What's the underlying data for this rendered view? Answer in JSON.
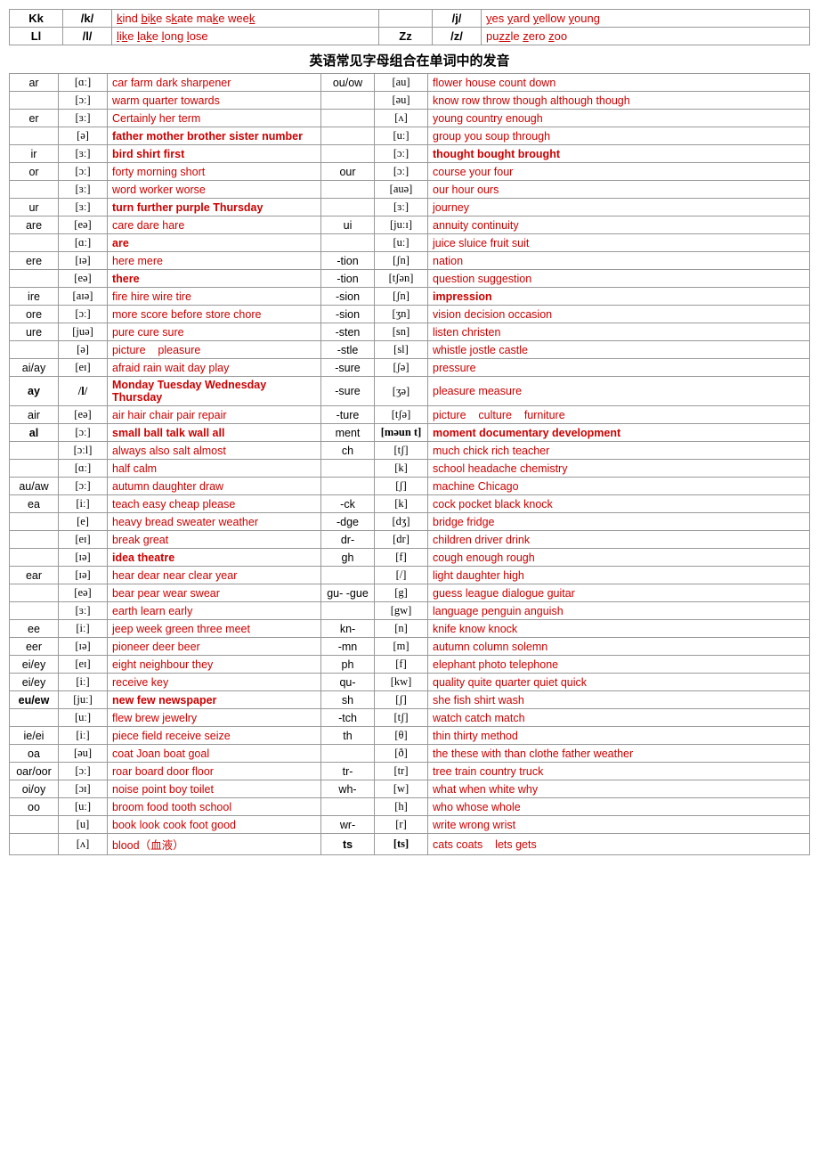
{
  "topTable": {
    "rows": [
      {
        "letter": "Kk",
        "ipa": "/k/",
        "examples": "kind bike skate make week",
        "letter2": "",
        "ipa2": "/j/",
        "examples2": "yes yard yellow young"
      },
      {
        "letter": "Ll",
        "ipa": "/l/",
        "examples": "like lake long lose",
        "letter2": "Zz",
        "ipa2": "/z/",
        "examples2": "puzzle zero zoo"
      }
    ]
  },
  "title": "英语常见字母组合在单词中的发音",
  "mainRows": [
    {
      "left_label": "ar",
      "left_phon": "[ɑː]",
      "left_words": "car farm dark sharpener",
      "right_label": "ou/ow",
      "right_phon": "[au]",
      "right_words": "flower house count down"
    },
    {
      "left_label": "",
      "left_phon": "[ɔː]",
      "left_words": "warm quarter towards",
      "right_label": "",
      "right_phon": "[əu]",
      "right_words": "know row throw though although though"
    },
    {
      "left_label": "er",
      "left_phon": "[ɜː]",
      "left_words": "Certainly her term",
      "right_label": "",
      "right_phon": "[ʌ]",
      "right_words": "young country enough"
    },
    {
      "left_label": "",
      "left_phon": "[ə]",
      "left_words_bold": "father mother brother sister number",
      "right_label": "",
      "right_phon": "[uː]",
      "right_words": "group you soup through"
    },
    {
      "left_label": "ir",
      "left_phon": "[ɜː]",
      "left_words_bold": "bird shirt first",
      "right_label": "",
      "right_phon": "[ɔː]",
      "right_words_bold": "thought bought brought"
    },
    {
      "left_label": "or",
      "left_phon": "[ɔː]",
      "left_words": "forty morning short",
      "right_label": "our",
      "right_phon": "[ɔː]",
      "right_words": "course your four"
    },
    {
      "left_label": "",
      "left_phon": "[ɜː]",
      "left_words": "word worker worse",
      "right_label": "",
      "right_phon": "[auə]",
      "right_words": "our hour ours"
    },
    {
      "left_label": "ur",
      "left_phon": "[ɜː]",
      "left_words_bold": "turn further purple Thursday",
      "right_label": "",
      "right_phon": "[ɜː]",
      "right_words": "journey"
    },
    {
      "left_label": "are",
      "left_phon": "[eə]",
      "left_words": "care dare hare",
      "right_label": "ui",
      "right_phon": "[juːɪ]",
      "right_words": "annuity continuity"
    },
    {
      "left_label": "",
      "left_phon": "[ɑː]",
      "left_words_bold": "are",
      "right_label": "",
      "right_phon": "[uː]",
      "right_words": "juice sluice fruit suit"
    },
    {
      "left_label": "ere",
      "left_phon": "[ɪə]",
      "left_words": "here mere",
      "right_label": "-tion",
      "right_phon": "[ʃn]",
      "right_words": "nation"
    },
    {
      "left_label": "",
      "left_phon": "[eə]",
      "left_words_bold": "there",
      "right_label": "-tion",
      "right_phon": "[tʃən]",
      "right_words": "question suggestion"
    },
    {
      "left_label": "ire",
      "left_phon": "[aɪə]",
      "left_words": "fire hire wire tire",
      "right_label": "-sion",
      "right_phon": "[ʃn]",
      "right_words_bold": "impression"
    },
    {
      "left_label": "ore",
      "left_phon": "[ɔː]",
      "left_words": "more score before store chore",
      "right_label": "-sion",
      "right_phon": "[ʒn]",
      "right_words": "vision decision occasion"
    },
    {
      "left_label": "ure",
      "left_phon": "[juə]",
      "left_words": "pure cure sure",
      "right_label": "-sten",
      "right_phon": "[sn]",
      "right_words": "listen christen"
    },
    {
      "left_label": "",
      "left_phon": "[ə]",
      "left_words": "picture   pleasure",
      "right_label": "-stle",
      "right_phon": "[sl]",
      "right_words": "whistle jostle castle"
    },
    {
      "left_label": "ai/ay",
      "left_phon": "[eɪ]",
      "left_words": "afraid rain wait day play",
      "right_label": "-sure",
      "right_phon": "[ʃə]",
      "right_words": "pressure"
    },
    {
      "left_label": "ay",
      "left_phon": "/l/",
      "left_words_bold": "Monday Tuesday Wednesday Thursday",
      "right_label": "-sure",
      "right_phon": "[ʒə]",
      "right_words": "pleasure measure"
    },
    {
      "left_label": "air",
      "left_phon": "[eə]",
      "left_words": "air hair chair pair repair",
      "right_label": "-ture",
      "right_phon": "[tʃə]",
      "right_words": "picture    culture    furniture"
    },
    {
      "left_label": "al",
      "left_phon": "[ɔː]",
      "left_words_bold": "small ball talk wall all",
      "right_label": "ment",
      "right_phon": "[məun t]",
      "right_words_bold": "moment documentary development"
    },
    {
      "left_label": "",
      "left_phon": "[ɔːl]",
      "left_words": "always also salt almost",
      "right_label": "ch",
      "right_phon": "[tʃ]",
      "right_words": "much chick rich teacher"
    },
    {
      "left_label": "",
      "left_phon": "[ɑː]",
      "left_words": "half calm",
      "right_label": "",
      "right_phon": "[k]",
      "right_words": "school headache chemistry"
    },
    {
      "left_label": "au/aw",
      "left_phon": "[ɔː]",
      "left_words": "autumn daughter draw",
      "right_label": "",
      "right_phon": "[ʃ]",
      "right_words": "machine Chicago"
    },
    {
      "left_label": "ea",
      "left_phon": "[iː]",
      "left_words": "teach easy cheap please",
      "right_label": "-ck",
      "right_phon": "[k]",
      "right_words": "cock pocket black knock"
    },
    {
      "left_label": "",
      "left_phon": "[e]",
      "left_words": "heavy bread sweater weather",
      "right_label": "-dge",
      "right_phon": "[dʒ]",
      "right_words": "bridge fridge"
    },
    {
      "left_label": "",
      "left_phon": "[eɪ]",
      "left_words": "break great",
      "right_label": "dr-",
      "right_phon": "[dr]",
      "right_words": "children driver drink"
    },
    {
      "left_label": "",
      "left_phon": "[ɪə]",
      "left_words_bold": "idea theatre",
      "right_label": "gh",
      "right_phon": "[f]",
      "right_words": "cough enough rough"
    },
    {
      "left_label": "ear",
      "left_phon": "[ɪə]",
      "left_words": "hear dear near clear year",
      "right_label": "",
      "right_phon": "[/]",
      "right_words": "light daughter high"
    },
    {
      "left_label": "",
      "left_phon": "[eə]",
      "left_words": "bear pear wear swear",
      "right_label": "gu- -gue",
      "right_phon": "[g]",
      "right_words": "guess league dialogue guitar"
    },
    {
      "left_label": "",
      "left_phon": "[ɜː]",
      "left_words": "earth learn early",
      "right_label": "",
      "right_phon": "[gw]",
      "right_words": "language penguin anguish"
    },
    {
      "left_label": "ee",
      "left_phon": "[iː]",
      "left_words": "jeep week green three meet",
      "right_label": "kn-",
      "right_phon": "[n]",
      "right_words": "knife know knock"
    },
    {
      "left_label": "eer",
      "left_phon": "[ɪə]",
      "left_words": "pioneer deer beer",
      "right_label": "-mn",
      "right_phon": "[m]",
      "right_words": "autumn column solemn"
    },
    {
      "left_label": "ei/ey",
      "left_phon": "[eɪ]",
      "left_words": "eight neighbour they",
      "right_label": "ph",
      "right_phon": "[f]",
      "right_words": "elephant photo telephone"
    },
    {
      "left_label": "ei/ey",
      "left_phon": "[iː]",
      "left_words": "receive key",
      "right_label": "qu-",
      "right_phon": "[kw]",
      "right_words": "quality quite quarter quiet quick"
    },
    {
      "left_label": "eu/ew",
      "left_phon": "[juː]",
      "left_words_bold": "new few newspaper",
      "right_label": "sh",
      "right_phon": "[ʃ]",
      "right_words": "she fish shirt wash"
    },
    {
      "left_label": "",
      "left_phon": "[uː]",
      "left_words": "flew brew jewelry",
      "right_label": "-tch",
      "right_phon": "[tʃ]",
      "right_words": "watch catch match"
    },
    {
      "left_label": "ie/ei",
      "left_phon": "[iː]",
      "left_words": "piece field receive seize",
      "right_label": "th",
      "right_phon": "[θ]",
      "right_words": "thin thirty method"
    },
    {
      "left_label": "oa",
      "left_phon": "[əu]",
      "left_words": "coat Joan boat goal",
      "right_label": "",
      "right_phon": "[ð]",
      "right_words": "the these with than clothe father weather"
    },
    {
      "left_label": "oar/oor",
      "left_phon": "[ɔː]",
      "left_words": "roar board door floor",
      "right_label": "tr-",
      "right_phon": "[tr]",
      "right_words": "tree train country truck"
    },
    {
      "left_label": "oi/oy",
      "left_phon": "[ɔɪ]",
      "left_words": "noise point boy toilet",
      "right_label": "wh-",
      "right_phon": "[w]",
      "right_words": "what when white why"
    },
    {
      "left_label": "oo",
      "left_phon": "[uː]",
      "left_words": "broom food tooth school",
      "right_label": "",
      "right_phon": "[h]",
      "right_words": "who whose whole"
    },
    {
      "left_label": "",
      "left_phon": "[u]",
      "left_words": "book look cook foot good",
      "right_label": "wr-",
      "right_phon": "[r]",
      "right_words": "write wrong wrist"
    },
    {
      "left_label": "",
      "left_phon": "[ʌ]",
      "left_words": "blood（血液）",
      "right_label": "ts",
      "right_phon": "[ts]",
      "right_words": "cats coats    lets gets"
    }
  ],
  "boldItems": {
    "father_mother": "father mother brother sister number",
    "bird_first": "bird first",
    "turn_further": "turn further purple Thursday",
    "are": "are",
    "there": "there",
    "impression": "impression",
    "monday_etc": "Monday Tuesday Wednesday Thursday",
    "small_ball": "small ball talk wall all",
    "moment": "moment documentary development",
    "idea_theatre": "idea theatre",
    "new_few": "new few newspaper"
  }
}
